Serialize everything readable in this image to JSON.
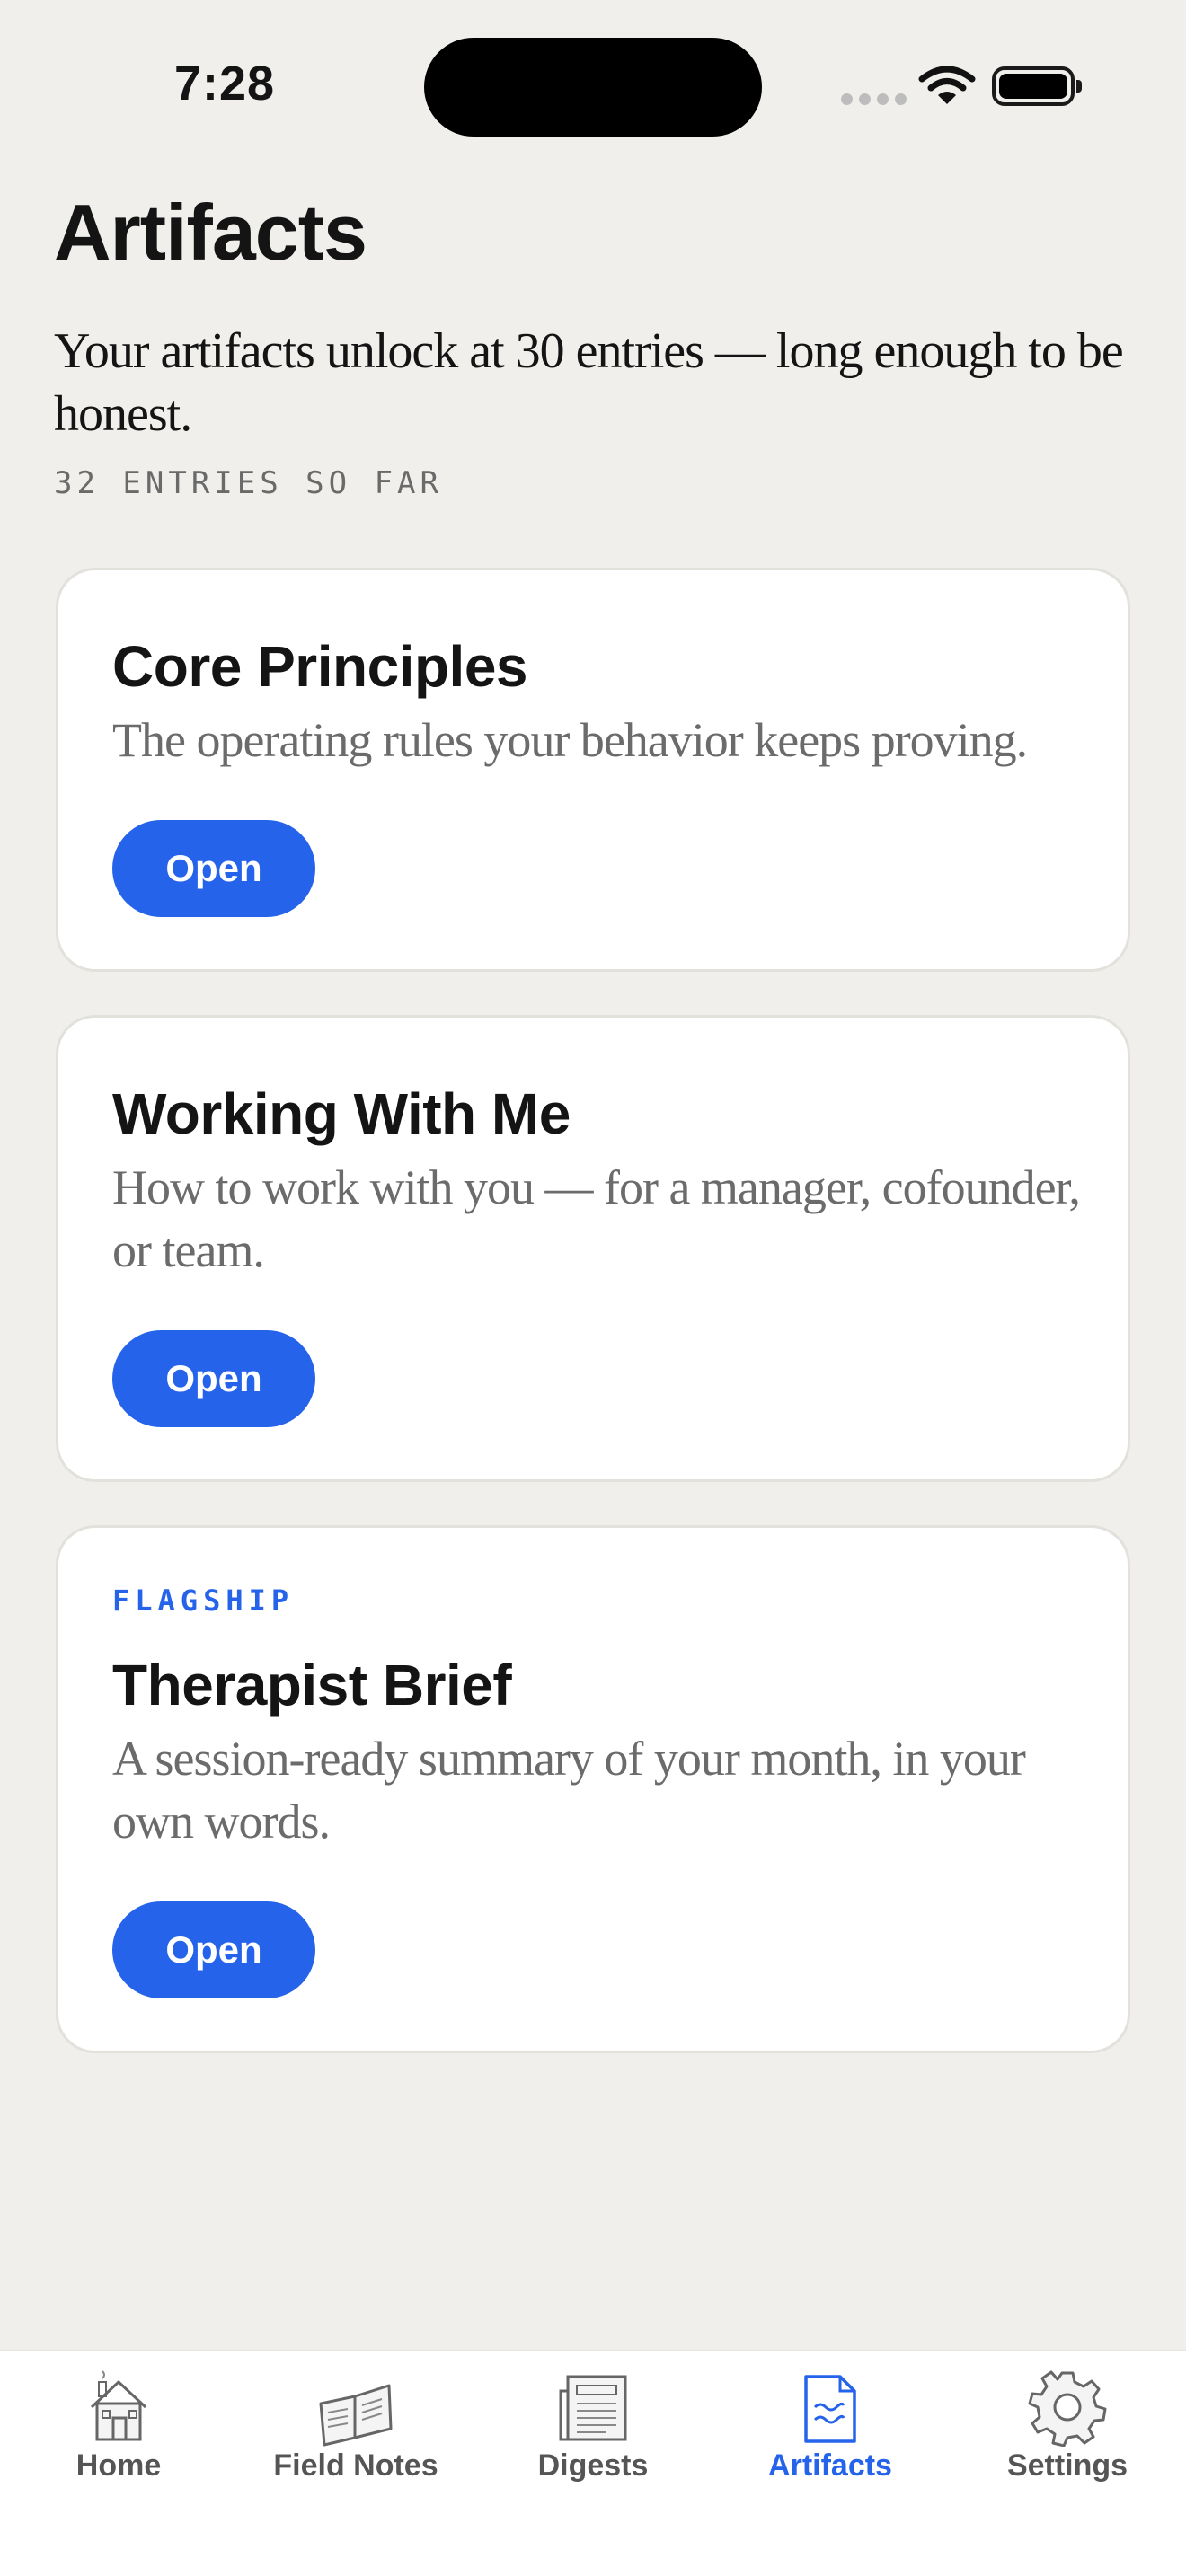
{
  "status_bar": {
    "time": "7:28"
  },
  "page": {
    "title": "Artifacts",
    "intro": "Your artifacts unlock at 30 entries — long enough to be honest.",
    "entry_count": "32 ENTRIES SO FAR"
  },
  "cards": [
    {
      "eyebrow": "",
      "title": "Core Principles",
      "description": "The operating rules your behavior keeps proving.",
      "button_label": "Open"
    },
    {
      "eyebrow": "",
      "title": "Working With Me",
      "description": "How to work with you — for a manager, cofounder, or team.",
      "button_label": "Open"
    },
    {
      "eyebrow": "FLAGSHIP",
      "title": "Therapist Brief",
      "description": "A session-ready summary of your month, in your own words.",
      "button_label": "Open"
    }
  ],
  "tab_bar": {
    "items": [
      {
        "label": "Home",
        "icon": "house-icon",
        "active": false
      },
      {
        "label": "Field Notes",
        "icon": "open-book-icon",
        "active": false
      },
      {
        "label": "Digests",
        "icon": "newspaper-icon",
        "active": false
      },
      {
        "label": "Artifacts",
        "icon": "document-icon",
        "active": true
      },
      {
        "label": "Settings",
        "icon": "gear-icon",
        "active": false
      }
    ]
  },
  "colors": {
    "accent": "#2563EB",
    "background": "#F0EFEC",
    "card": "#FFFFFF",
    "muted_text": "#6B6B6B"
  }
}
